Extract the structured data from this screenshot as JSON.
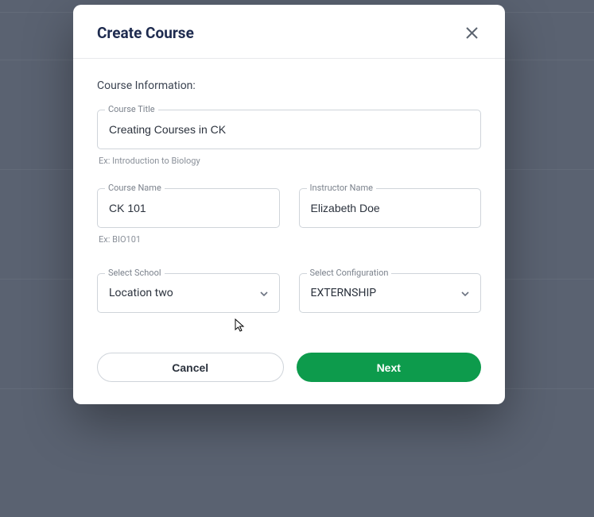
{
  "modal": {
    "title": "Create Course",
    "section_label": "Course Information:",
    "course_title": {
      "label": "Course Title",
      "value": "Creating Courses in CK",
      "helper": "Ex: Introduction to Biology"
    },
    "course_name": {
      "label": "Course Name",
      "value": "CK 101",
      "helper": "Ex: BIO101"
    },
    "instructor_name": {
      "label": "Instructor Name",
      "value": "Elizabeth Doe"
    },
    "select_school": {
      "label": "Select School",
      "value": "Location two"
    },
    "select_config": {
      "label": "Select Configuration",
      "value": "EXTERNSHIP"
    },
    "cancel_label": "Cancel",
    "next_label": "Next"
  }
}
